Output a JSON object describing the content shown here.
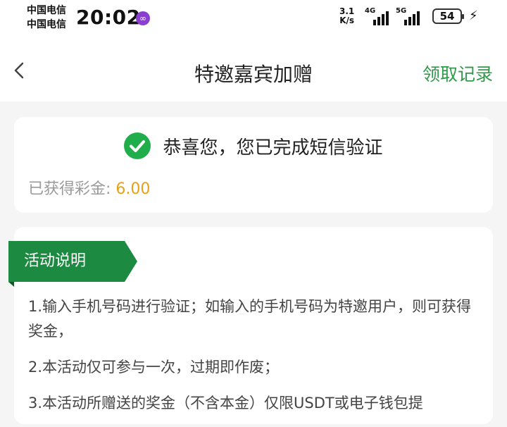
{
  "status_bar": {
    "carrier_1": "中国电信",
    "carrier_2": "中国电信",
    "time": "20:02",
    "speed_value": "3.1",
    "speed_unit": "K/s",
    "net_1": "4G",
    "net_2": "5G",
    "battery": "54",
    "app_icon": "infinity-icon"
  },
  "nav": {
    "title": "特邀嘉宾加赠",
    "action": "领取记录",
    "back_icon": "chevron-left-icon"
  },
  "verification": {
    "message": "恭喜您，您已完成短信验证",
    "reward_label": "已获得彩金:",
    "reward_value": "6.00",
    "icon": "check-circle-icon"
  },
  "activity": {
    "tag": "活动说明",
    "rules": [
      "1.输入手机号码进行验证；如输入的手机号码为特邀用户，则可获得奖金，",
      "2.本活动仅可参与一次，过期即作废；",
      "3.本活动所赠送的奖金（不含本金）仅限USDT或电子钱包提"
    ]
  },
  "colors": {
    "accent_green": "#1d8a41",
    "nav_action_green": "#2f9a4a",
    "reward_gold": "#e8a01b"
  }
}
